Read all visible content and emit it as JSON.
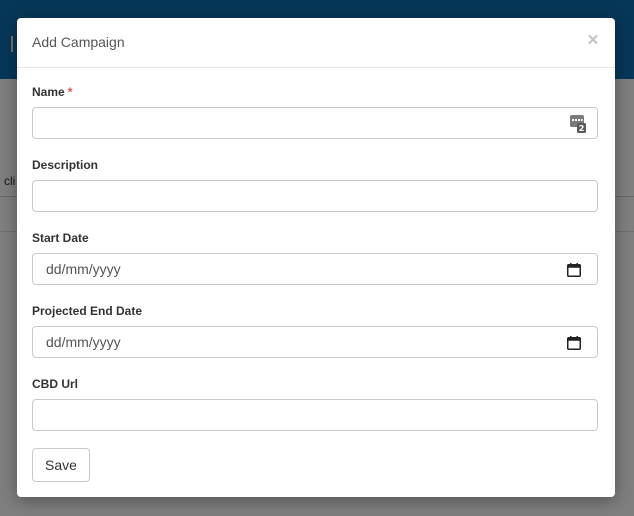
{
  "background": {
    "partial_text": "cli"
  },
  "modal": {
    "title": "Add Campaign",
    "close_glyph": "×",
    "fields": [
      {
        "label": "Name",
        "required": true,
        "required_mark": "*",
        "value": "",
        "icon": "keyboard-badge-icon"
      },
      {
        "label": "Description",
        "required": false,
        "value": ""
      },
      {
        "label": "Start Date",
        "required": false,
        "placeholder": "dd/mm/yyyy",
        "icon": "calendar-icon"
      },
      {
        "label": "Projected End Date",
        "required": false,
        "placeholder": "dd/mm/yyyy",
        "icon": "calendar-icon"
      },
      {
        "label": "CBD Url",
        "required": false,
        "value": ""
      }
    ],
    "save_label": "Save"
  },
  "colors": {
    "topbar": "#0f6fb0",
    "required": "#d9534f",
    "overlay": "rgba(0,0,0,0.5)"
  }
}
